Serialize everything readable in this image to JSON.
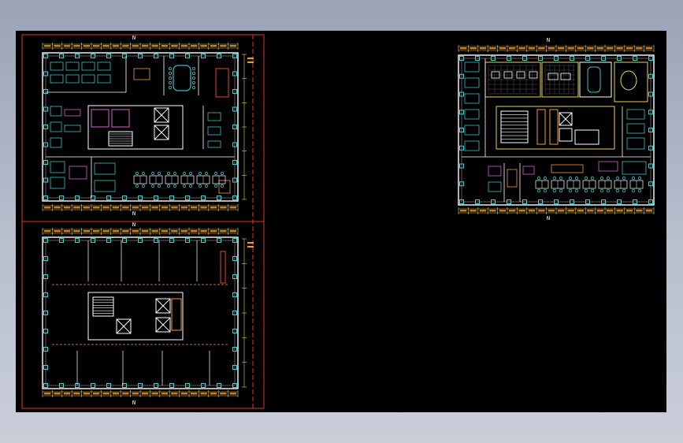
{
  "viewport": {
    "background": "#000000",
    "surround": "#a9b1c2"
  },
  "drawing": {
    "sheets": [
      {
        "id": "plan-upper-left",
        "kind": "furnished floor plan",
        "north_marker": "N"
      },
      {
        "id": "plan-lower-left",
        "kind": "structural / outline plan",
        "north_marker": "N"
      },
      {
        "id": "plan-right",
        "kind": "furnished floor plan",
        "north_marker": "N"
      }
    ],
    "colors": {
      "frame": "#e0392b",
      "walls": "#ffffff",
      "columns": "#3ad0d8",
      "dimensions": "#e8d24a",
      "furniture": "#31c4c9",
      "accent": "#d95fd6",
      "annotation": "#f39a3e"
    }
  }
}
